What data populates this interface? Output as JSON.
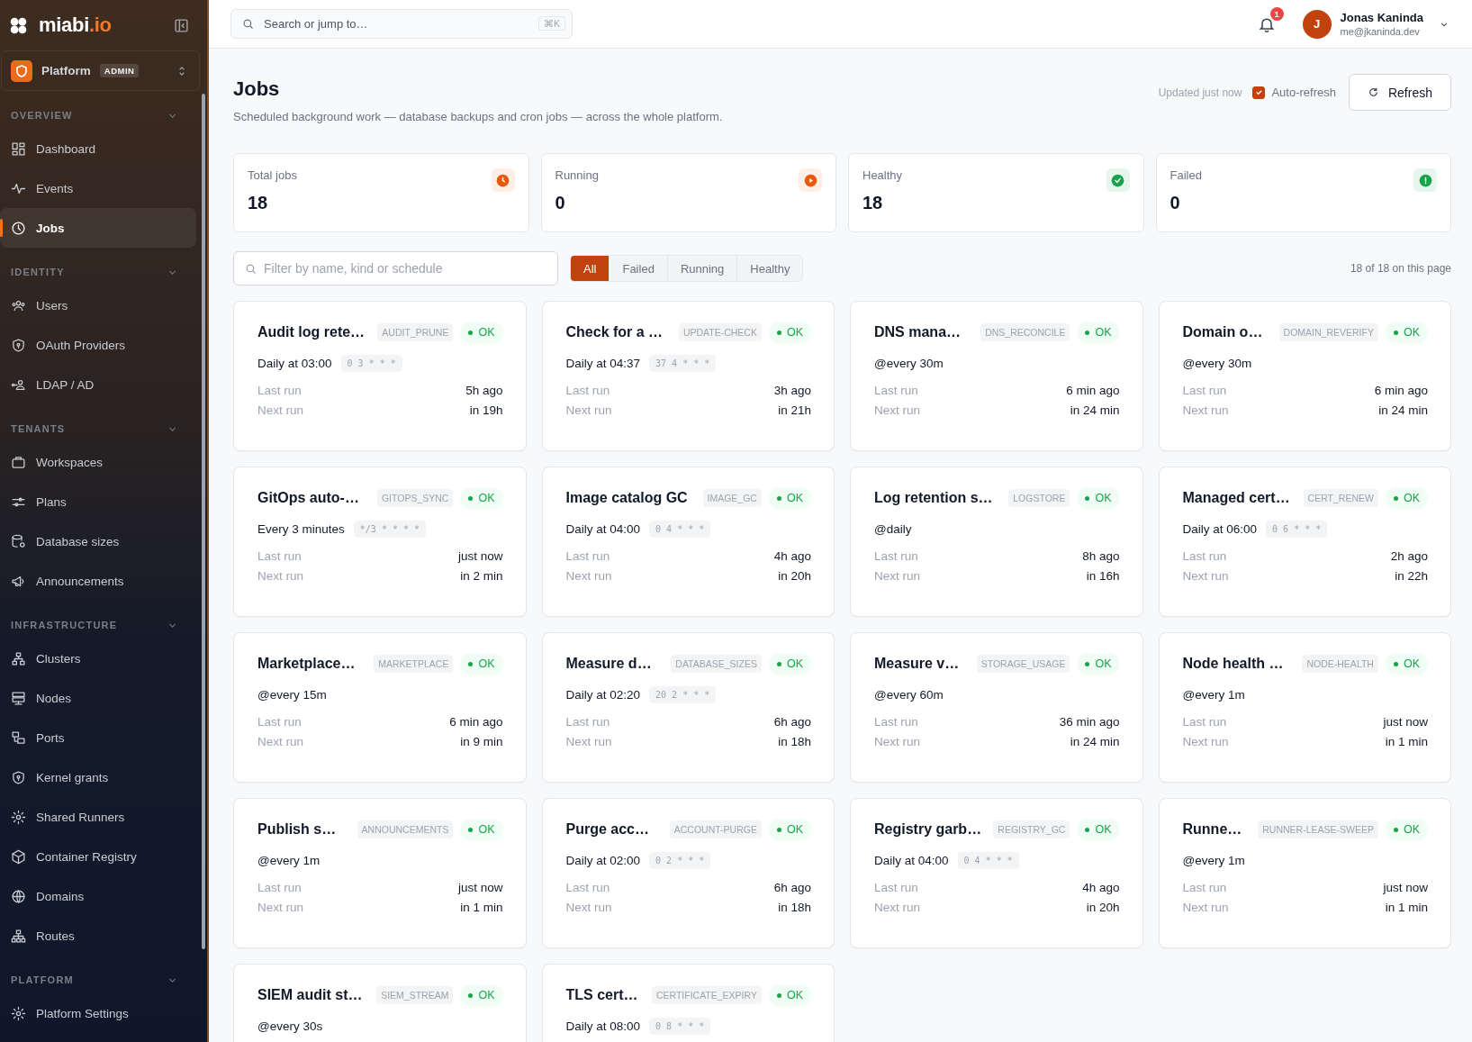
{
  "sidebar": {
    "brand": {
      "name": "miabi",
      "suffix": ".io"
    },
    "switcher": {
      "label": "Platform",
      "badge": "ADMIN"
    },
    "sections": [
      {
        "title": "OVERVIEW",
        "expanded": true,
        "items": [
          {
            "label": "Dashboard",
            "selected": false
          },
          {
            "label": "Events",
            "selected": false
          },
          {
            "label": "Jobs",
            "selected": true
          }
        ]
      },
      {
        "title": "IDENTITY",
        "expanded": true,
        "items": [
          {
            "label": "Users",
            "selected": false
          },
          {
            "label": "OAuth Providers",
            "selected": false
          },
          {
            "label": "LDAP / AD",
            "selected": false
          }
        ]
      },
      {
        "title": "TENANTS",
        "expanded": true,
        "items": [
          {
            "label": "Workspaces",
            "selected": false
          },
          {
            "label": "Plans",
            "selected": false
          },
          {
            "label": "Database sizes",
            "selected": false
          },
          {
            "label": "Announcements",
            "selected": false
          }
        ]
      },
      {
        "title": "INFRASTRUCTURE",
        "expanded": true,
        "items": [
          {
            "label": "Clusters",
            "selected": false
          },
          {
            "label": "Nodes",
            "selected": false
          },
          {
            "label": "Ports",
            "selected": false
          },
          {
            "label": "Kernel grants",
            "selected": false
          },
          {
            "label": "Shared Runners",
            "selected": false
          },
          {
            "label": "Container Registry",
            "selected": false
          },
          {
            "label": "Domains",
            "selected": false
          },
          {
            "label": "Routes",
            "selected": false
          }
        ]
      },
      {
        "title": "PLATFORM",
        "expanded": true,
        "items": [
          {
            "label": "Platform Settings",
            "selected": false
          }
        ]
      }
    ]
  },
  "topbar": {
    "search": {
      "placeholder": "Search or jump to…",
      "shortcut": "⌘K"
    },
    "notifications": {
      "count": "1"
    },
    "user": {
      "initial": "J",
      "name": "Jonas Kaninda",
      "email": "me@jkaninda.dev"
    }
  },
  "page": {
    "title": "Jobs",
    "subtitle": "Scheduled background work — database backups and cron jobs — across the whole platform.",
    "updated": "Updated just now",
    "auto_refresh": {
      "label": "Auto-refresh",
      "checked": true
    },
    "refresh_button": "Refresh"
  },
  "stats": [
    {
      "label": "Total jobs",
      "value": "18",
      "kind": "clock",
      "color": "#ea580c"
    },
    {
      "label": "Running",
      "value": "0",
      "kind": "play",
      "color": "#ea580c"
    },
    {
      "label": "Healthy",
      "value": "18",
      "kind": "check",
      "color": "#16a34a"
    },
    {
      "label": "Failed",
      "value": "0",
      "kind": "alert",
      "color": "#16a34a"
    }
  ],
  "filter": {
    "placeholder": "Filter by name, kind or schedule",
    "tabs": [
      {
        "label": "All",
        "selected": true
      },
      {
        "label": "Failed",
        "selected": false
      },
      {
        "label": "Running",
        "selected": false
      },
      {
        "label": "Healthy",
        "selected": false
      }
    ],
    "count": "18 of 18 on this page"
  },
  "jobs": [
    {
      "name": "Audit log rete…",
      "kind": "AUDIT_PRUNE",
      "status": "OK",
      "schedule": "Daily at 03:00",
      "cron": "0 3 * * *",
      "runs": [
        {
          "label": "Last run",
          "value": "5h ago"
        },
        {
          "label": "Next run",
          "value": "in 19h"
        }
      ]
    },
    {
      "name": "Check for a …",
      "kind": "UPDATE-CHECK",
      "status": "OK",
      "schedule": "Daily at 04:37",
      "cron": "37 4 * * *",
      "runs": [
        {
          "label": "Last run",
          "value": "3h ago"
        },
        {
          "label": "Next run",
          "value": "in 21h"
        }
      ]
    },
    {
      "name": "DNS mana…",
      "kind": "DNS_RECONCILE",
      "status": "OK",
      "schedule": "@every 30m",
      "runs": [
        {
          "label": "Last run",
          "value": "6 min ago"
        },
        {
          "label": "Next run",
          "value": "in 24 min"
        }
      ]
    },
    {
      "name": "Domain o…",
      "kind": "DOMAIN_REVERIFY",
      "status": "OK",
      "schedule": "@every 30m",
      "runs": [
        {
          "label": "Last run",
          "value": "6 min ago"
        },
        {
          "label": "Next run",
          "value": "in 24 min"
        }
      ]
    },
    {
      "name": "GitOps auto-…",
      "kind": "GITOPS_SYNC",
      "status": "OK",
      "schedule": "Every 3 minutes",
      "cron": "*/3 * * * *",
      "runs": [
        {
          "label": "Last run",
          "value": "just now"
        },
        {
          "label": "Next run",
          "value": "in 2 min"
        }
      ]
    },
    {
      "name": "Image catalog GC",
      "kind": "IMAGE_GC",
      "status": "OK",
      "schedule": "Daily at 04:00",
      "cron": "0 4 * * *",
      "runs": [
        {
          "label": "Last run",
          "value": "4h ago"
        },
        {
          "label": "Next run",
          "value": "in 20h"
        }
      ]
    },
    {
      "name": "Log retention s…",
      "kind": "LOGSTORE",
      "status": "OK",
      "schedule": "@daily",
      "runs": [
        {
          "label": "Last run",
          "value": "8h ago"
        },
        {
          "label": "Next run",
          "value": "in 16h"
        }
      ]
    },
    {
      "name": "Managed cert…",
      "kind": "CERT_RENEW",
      "status": "OK",
      "schedule": "Daily at 06:00",
      "cron": "0 6 * * *",
      "runs": [
        {
          "label": "Last run",
          "value": "2h ago"
        },
        {
          "label": "Next run",
          "value": "in 22h"
        }
      ]
    },
    {
      "name": "Marketplace…",
      "kind": "MARKETPLACE",
      "status": "OK",
      "schedule": "@every 15m",
      "runs": [
        {
          "label": "Last run",
          "value": "6 min ago"
        },
        {
          "label": "Next run",
          "value": "in 9 min"
        }
      ]
    },
    {
      "name": "Measure d…",
      "kind": "DATABASE_SIZES",
      "status": "OK",
      "schedule": "Daily at 02:20",
      "cron": "20 2 * * *",
      "runs": [
        {
          "label": "Last run",
          "value": "6h ago"
        },
        {
          "label": "Next run",
          "value": "in 18h"
        }
      ]
    },
    {
      "name": "Measure v…",
      "kind": "STORAGE_USAGE",
      "status": "OK",
      "schedule": "@every 60m",
      "runs": [
        {
          "label": "Last run",
          "value": "36 min ago"
        },
        {
          "label": "Next run",
          "value": "in 24 min"
        }
      ]
    },
    {
      "name": "Node health …",
      "kind": "NODE-HEALTH",
      "status": "OK",
      "schedule": "@every 1m",
      "runs": [
        {
          "label": "Last run",
          "value": "just now"
        },
        {
          "label": "Next run",
          "value": "in 1 min"
        }
      ]
    },
    {
      "name": "Publish s…",
      "kind": "ANNOUNCEMENTS",
      "status": "OK",
      "schedule": "@every 1m",
      "runs": [
        {
          "label": "Last run",
          "value": "just now"
        },
        {
          "label": "Next run",
          "value": "in 1 min"
        }
      ]
    },
    {
      "name": "Purge acc…",
      "kind": "ACCOUNT-PURGE",
      "status": "OK",
      "schedule": "Daily at 02:00",
      "cron": "0 2 * * *",
      "runs": [
        {
          "label": "Last run",
          "value": "6h ago"
        },
        {
          "label": "Next run",
          "value": "in 18h"
        }
      ]
    },
    {
      "name": "Registry garb…",
      "kind": "REGISTRY_GC",
      "status": "OK",
      "schedule": "Daily at 04:00",
      "cron": "0 4 * * *",
      "runs": [
        {
          "label": "Last run",
          "value": "4h ago"
        },
        {
          "label": "Next run",
          "value": "in 20h"
        }
      ]
    },
    {
      "name": "Runne…",
      "kind": "RUNNER-LEASE-SWEEP",
      "status": "OK",
      "schedule": "@every 1m",
      "runs": [
        {
          "label": "Last run",
          "value": "just now"
        },
        {
          "label": "Next run",
          "value": "in 1 min"
        }
      ]
    },
    {
      "name": "SIEM audit st…",
      "kind": "SIEM_STREAM",
      "status": "OK",
      "schedule": "@every 30s"
    },
    {
      "name": "TLS cert…",
      "kind": "CERTIFICATE_EXPIRY",
      "status": "OK",
      "schedule": "Daily at 08:00",
      "cron": "0 8 * * *"
    }
  ]
}
